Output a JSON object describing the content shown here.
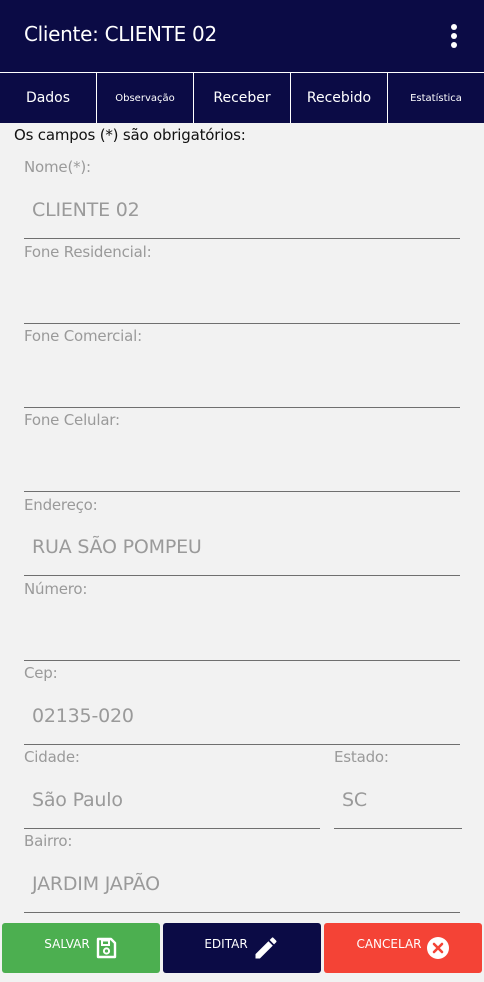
{
  "appbar": {
    "title": "Cliente: CLIENTE 02"
  },
  "tabs": [
    {
      "label": "Dados"
    },
    {
      "label": "Observação"
    },
    {
      "label": "Receber"
    },
    {
      "label": "Recebido"
    },
    {
      "label": "Estatística"
    }
  ],
  "note": "Os campos (*) são obrigatórios:",
  "fields": {
    "nome": {
      "label": "Nome(*):",
      "value": "CLIENTE 02"
    },
    "fone_residencial": {
      "label": "Fone Residencial:",
      "value": ""
    },
    "fone_comercial": {
      "label": "Fone Comercial:",
      "value": ""
    },
    "fone_celular": {
      "label": "Fone Celular:",
      "value": ""
    },
    "endereco": {
      "label": "Endereço:",
      "value": "RUA SÃO POMPEU"
    },
    "numero": {
      "label": "Número:",
      "value": ""
    },
    "cep": {
      "label": "Cep:",
      "value": "02135-020"
    },
    "cidade": {
      "label": "Cidade:",
      "value": "São Paulo"
    },
    "estado": {
      "label": "Estado:",
      "value": "SC"
    },
    "bairro": {
      "label": "Bairro:",
      "value": "JARDIM JAPÃO"
    }
  },
  "buttons": {
    "salvar": "SALVAR",
    "editar": "EDITAR",
    "cancelar": "CANCELAR"
  },
  "colors": {
    "header": "#0b0b45",
    "salvar": "#4caf50",
    "editar": "#0b0b45",
    "cancelar": "#f44336"
  },
  "icons": {
    "menu": "more-vert-icon",
    "salvar": "save-icon",
    "editar": "pencil-icon",
    "cancelar": "cancel-circle-icon"
  }
}
